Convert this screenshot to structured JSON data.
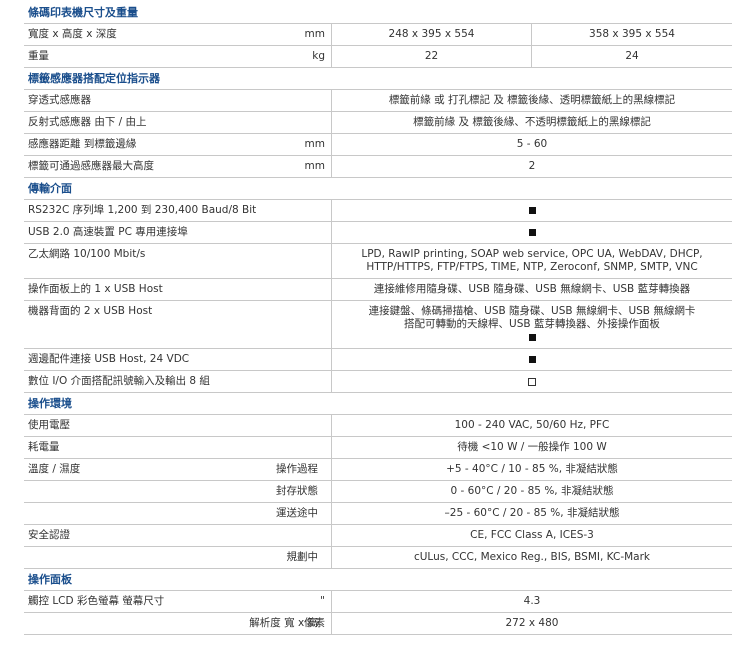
{
  "sections": [
    {
      "title": "條碼印表機尺寸及重量",
      "rows": [
        {
          "label": "寬度 x 高度 x 深度",
          "unit": "mm",
          "values": [
            "248 x 395 x 554",
            "358 x 395 x 554"
          ]
        },
        {
          "label": "重量",
          "unit": "kg",
          "values": [
            "22",
            "24"
          ]
        }
      ]
    },
    {
      "title": "標籤感應器搭配定位指示器",
      "rows": [
        {
          "label": "穿透式感應器",
          "values": [
            "標籤前緣 或 打孔標記 及 標籤後緣、透明標籤紙上的黑線標記"
          ]
        },
        {
          "label": "反射式感應器 由下 / 由上",
          "values": [
            "標籤前緣 及 標籤後緣、不透明標籤紙上的黑線標記"
          ]
        },
        {
          "label": "感應器距離 到標籤邊緣",
          "unit": "mm",
          "values": [
            "5 - 60"
          ]
        },
        {
          "label": "標籤可通過感應器最大高度",
          "unit": "mm",
          "values": [
            "2"
          ]
        }
      ]
    },
    {
      "title": "傳輸介面",
      "rows": [
        {
          "label": "RS232C 序列埠 1,200 到 230,400 Baud/8 Bit",
          "mark": "filled"
        },
        {
          "label": "USB 2.0 高速裝置 PC 專用連接埠",
          "mark": "filled"
        },
        {
          "label": "乙太網路 10/100 Mbit/s",
          "values": [
            "LPD, RawIP printing, SOAP web service, OPC UA, WebDAV, DHCP,",
            "HTTP/HTTPS, FTP/FTPS, TIME, NTP, Zeroconf, SNMP, SMTP, VNC"
          ]
        },
        {
          "label": "操作面板上的 1 x USB Host",
          "values": [
            "連接維修用隨身碟、USB 隨身碟、USB 無線網卡、USB 藍芽轉換器"
          ]
        },
        {
          "label": "機器背面的 2 x USB Host",
          "values": [
            "連接鍵盤、條碼掃描槍、USB 隨身碟、USB 無線網卡、USB 無線網卡",
            "搭配可轉動的天線桿、USB 藍芽轉換器、外接操作面板"
          ],
          "mark": "filled"
        },
        {
          "label": "週邊配件連接 USB Host, 24 VDC",
          "mark": "filled"
        },
        {
          "label": "數位 I/O 介面搭配訊號輸入及輸出 8 組",
          "mark": "empty"
        }
      ]
    },
    {
      "title": "操作環境",
      "rows": [
        {
          "label": "使用電壓",
          "values": [
            "100 - 240 VAC, 50/60 Hz, PFC"
          ]
        },
        {
          "label": "耗電量",
          "values": [
            "待機 <10 W / 一般操作 100 W"
          ]
        },
        {
          "label": "溫度 / 濕度",
          "sublabel": "操作過程",
          "values": [
            "+5 - 40°C / 10 - 85 %, 非凝結狀態"
          ]
        },
        {
          "sublabel": "封存狀態",
          "values": [
            "0 - 60°C / 20 - 85 %, 非凝結狀態"
          ]
        },
        {
          "sublabel": "運送途中",
          "values": [
            "–25 - 60°C / 20 - 85 %, 非凝結狀態"
          ]
        },
        {
          "label": "安全認證",
          "values": [
            "CE, FCC Class A, ICES-3"
          ]
        },
        {
          "sublabel": "規劃中",
          "values": [
            "cULus, CCC, Mexico Reg., BIS, BSMI, KC-Mark"
          ]
        }
      ]
    },
    {
      "title": "操作面板",
      "rows": [
        {
          "label": "觸控 LCD 彩色螢幕 螢幕尺寸",
          "unit": "\"",
          "values": [
            "4.3"
          ]
        },
        {
          "sublabel": "解析度 寬 x 高",
          "unit": "像素",
          "values": [
            "272 x 480"
          ]
        }
      ]
    }
  ]
}
